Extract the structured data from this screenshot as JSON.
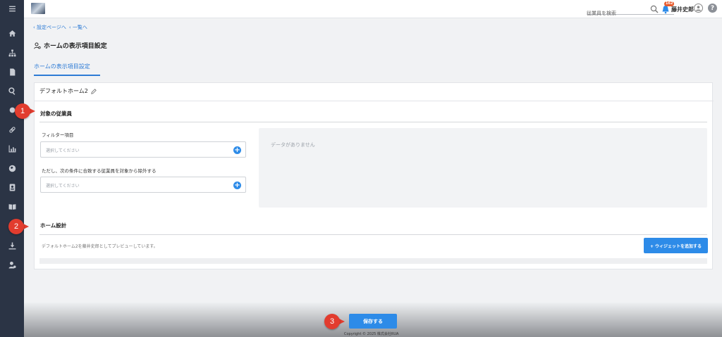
{
  "header": {
    "search_placeholder": "従業員を検索",
    "notification_count": "162",
    "user_name": "藤井史郎",
    "help_label": "?"
  },
  "sidebar": {
    "icons": [
      "menu-icon",
      "home-icon",
      "org-chart-icon",
      "document-icon",
      "search-icon",
      "comment-icon",
      "link-icon",
      "chart-icon",
      "globe-icon",
      "contact-card-icon",
      "book-icon",
      "download-icon",
      "user-settings-icon"
    ]
  },
  "breadcrumb": {
    "settings_link": "設定ページへ",
    "list_link": "一覧へ"
  },
  "page": {
    "title": "ホームの表示項目設定",
    "tab_label": "ホームの表示項目設定"
  },
  "card": {
    "home_name": "デフォルトホーム2",
    "target_section": "対象の従業員",
    "filter_label": "フィルター項目",
    "filter_placeholder": "選択してください",
    "exclude_label": "ただし、次の条件に合致する従業員を対象から除外する",
    "exclude_placeholder": "選択してください",
    "no_data": "データがありません",
    "design_section": "ホーム設計",
    "preview_text": "デフォルトホーム2を藤井史郎としてプレビューしています。",
    "add_widget_button": "+ ウィジェットを追加する"
  },
  "footer": {
    "save_button": "保存する",
    "copyright": "Copyright © 2025 株式会社RUA"
  },
  "callouts": [
    "1",
    "2",
    "3"
  ],
  "colors": {
    "accent": "#2d8be8",
    "sidebar": "#2b3445",
    "callout": "#e23c2e"
  }
}
